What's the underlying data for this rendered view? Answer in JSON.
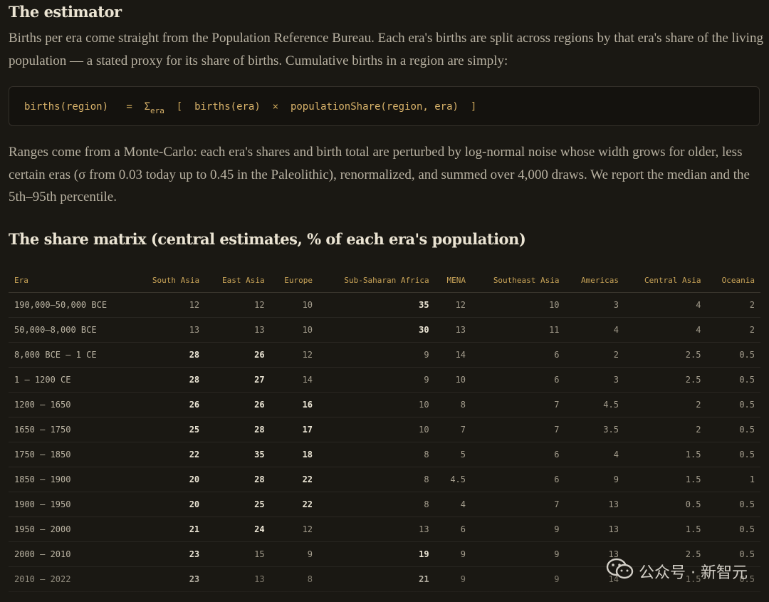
{
  "estimator": {
    "heading": "The estimator",
    "paragraph1": "Births per era come straight from the Population Reference Bureau. Each era's births are split across regions by that era's share of the living population — a stated proxy for its share of births. Cumulative births in a region are simply:",
    "formula": {
      "lhs": "births(region)",
      "equals": "=",
      "sigma": "Σ",
      "sub": "era",
      "open": "[",
      "term1": "births(era)",
      "times": "×",
      "term2": "populationShare(region, era)",
      "close": "]"
    },
    "paragraph2": "Ranges come from a Monte-Carlo: each era's shares and birth total are perturbed by log-normal noise whose width grows for older, less certain eras (σ from 0.03 today up to 0.45 in the Paleolithic), renormalized, and summed over 4,000 draws. We report the median and the 5th–95th percentile."
  },
  "matrix": {
    "heading": "The share matrix (central estimates, % of each era's population)",
    "columns": [
      "Era",
      "South Asia",
      "East Asia",
      "Europe",
      "Sub-Saharan Africa",
      "MENA",
      "Southeast Asia",
      "Americas",
      "Central Asia",
      "Oceania"
    ],
    "rows": [
      {
        "cells": [
          "190,000–50,000 BCE",
          "12",
          "12",
          "10",
          "35",
          "12",
          "10",
          "3",
          "4",
          "2"
        ],
        "bold": [
          4
        ]
      },
      {
        "cells": [
          "50,000–8,000 BCE",
          "13",
          "13",
          "10",
          "30",
          "13",
          "11",
          "4",
          "4",
          "2"
        ],
        "bold": [
          4
        ]
      },
      {
        "cells": [
          "8,000 BCE – 1 CE",
          "28",
          "26",
          "12",
          "9",
          "14",
          "6",
          "2",
          "2.5",
          "0.5"
        ],
        "bold": [
          1,
          2
        ]
      },
      {
        "cells": [
          "1 – 1200 CE",
          "28",
          "27",
          "14",
          "9",
          "10",
          "6",
          "3",
          "2.5",
          "0.5"
        ],
        "bold": [
          1,
          2
        ]
      },
      {
        "cells": [
          "1200 – 1650",
          "26",
          "26",
          "16",
          "10",
          "8",
          "7",
          "4.5",
          "2",
          "0.5"
        ],
        "bold": [
          1,
          2,
          3
        ]
      },
      {
        "cells": [
          "1650 – 1750",
          "25",
          "28",
          "17",
          "10",
          "7",
          "7",
          "3.5",
          "2",
          "0.5"
        ],
        "bold": [
          1,
          2,
          3
        ]
      },
      {
        "cells": [
          "1750 – 1850",
          "22",
          "35",
          "18",
          "8",
          "5",
          "6",
          "4",
          "1.5",
          "0.5"
        ],
        "bold": [
          1,
          2,
          3
        ]
      },
      {
        "cells": [
          "1850 – 1900",
          "20",
          "28",
          "22",
          "8",
          "4.5",
          "6",
          "9",
          "1.5",
          "1"
        ],
        "bold": [
          1,
          2,
          3
        ]
      },
      {
        "cells": [
          "1900 – 1950",
          "20",
          "25",
          "22",
          "8",
          "4",
          "7",
          "13",
          "0.5",
          "0.5"
        ],
        "bold": [
          1,
          2,
          3
        ]
      },
      {
        "cells": [
          "1950 – 2000",
          "21",
          "24",
          "12",
          "13",
          "6",
          "9",
          "13",
          "1.5",
          "0.5"
        ],
        "bold": [
          1,
          2
        ]
      },
      {
        "cells": [
          "2000 – 2010",
          "23",
          "15",
          "9",
          "19",
          "9",
          "9",
          "13",
          "2.5",
          "0.5"
        ],
        "bold": [
          1,
          4
        ]
      },
      {
        "cells": [
          "2010 – 2022",
          "23",
          "13",
          "8",
          "21",
          "9",
          "9",
          "14",
          "1.5",
          "0.5"
        ],
        "bold": [
          1,
          4
        ]
      }
    ]
  },
  "watermark": {
    "icon": "wechat-icon",
    "text": "公众号 · 新智元"
  }
}
